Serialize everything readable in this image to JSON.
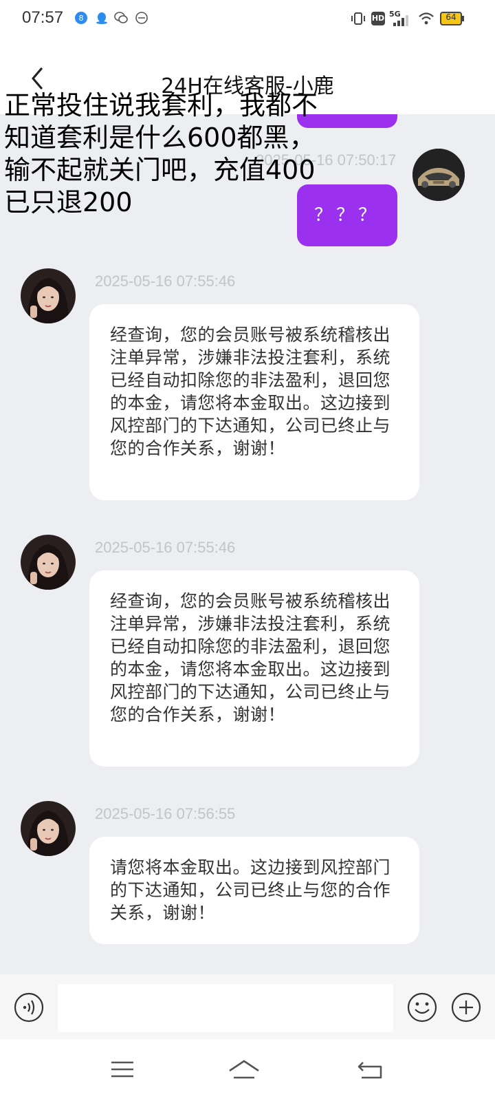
{
  "status_bar": {
    "time": "07:57",
    "network_label": "5G",
    "hd_label": "HD",
    "battery_level": "64"
  },
  "header": {
    "title": "24H在线客服-小鹿"
  },
  "overlay_caption": {
    "lines": [
      "正常投住说我套利，我都不",
      "知道套利是什么600都黑，",
      "输不起就关门吧，充值400",
      "已只退200"
    ]
  },
  "messages": {
    "sent_timestamp": "2025-05-16 07:50:17",
    "sent_text": "？？？",
    "received": [
      {
        "timestamp": "2025-05-16 07:55:46",
        "text": "经查询，您的会员账号被系统稽核出注单异常，涉嫌非法投注套利，系统已经自动扣除您的非法盈利，退回您的本金，请您将本金取出。这边接到风控部门的下达通知，公司已终止与您的合作关系，谢谢！"
      },
      {
        "timestamp": "2025-05-16 07:55:46",
        "text": "经查询，您的会员账号被系统稽核出注单异常，涉嫌非法投注套利，系统已经自动扣除您的非法盈利，退回您的本金，请您将本金取出。这边接到风控部门的下达通知，公司已终止与您的合作关系，谢谢！"
      },
      {
        "timestamp": "2025-05-16 07:56:55",
        "text": "请您将本金取出。这边接到风控部门的下达通知，公司已终止与您的合作关系，谢谢！"
      }
    ]
  },
  "input": {
    "value": "",
    "placeholder": ""
  },
  "icons": {
    "back": "chevron-left-icon",
    "voice": "voice-icon",
    "emoji": "emoji-icon",
    "plus": "plus-icon",
    "menu": "menu-icon",
    "home": "home-icon",
    "return": "back-arrow-icon"
  },
  "colors": {
    "accent_purple": "#9b30ee",
    "chat_background": "#eceef1",
    "bubble_white": "#ffffff",
    "timestamp_gray": "#c2c4c8"
  }
}
